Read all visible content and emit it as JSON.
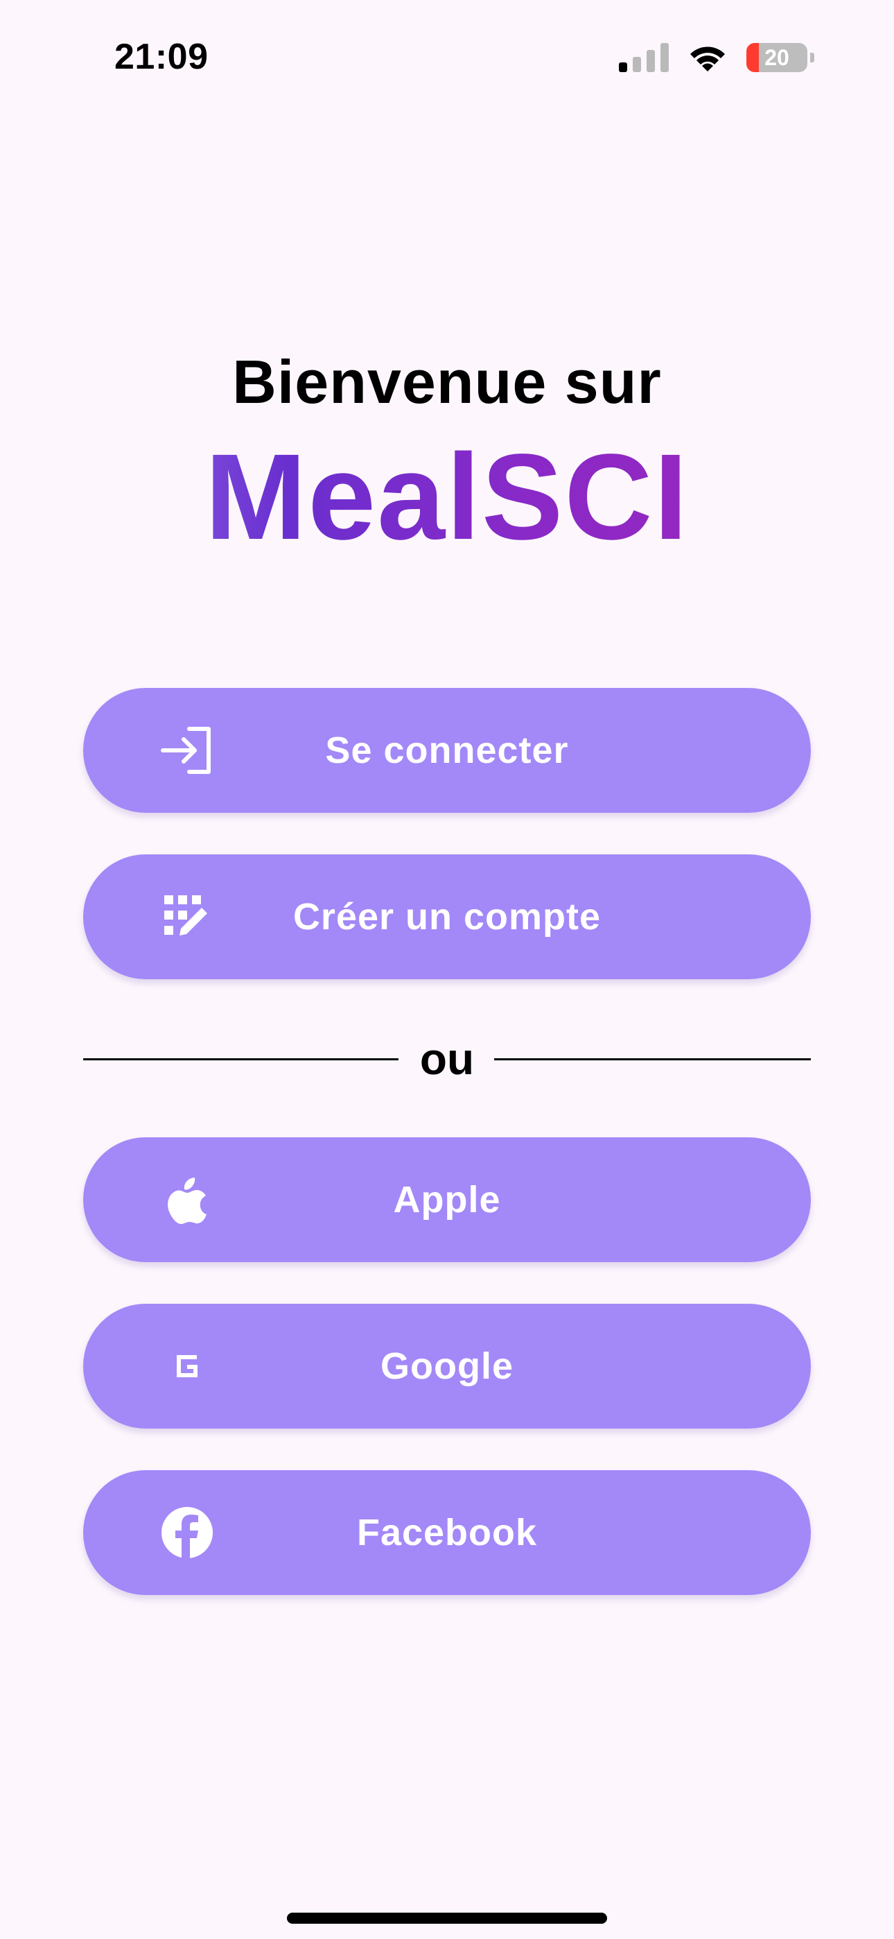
{
  "status_bar": {
    "time": "21:09",
    "battery_level": "20",
    "battery_fraction": 0.2,
    "battery_color": "#ff3b30"
  },
  "header": {
    "welcome": "Bienvenue sur",
    "brand": "MealSCI"
  },
  "buttons": {
    "login": {
      "label": "Se connecter",
      "icon": "login-icon"
    },
    "register": {
      "label": "Créer un compte",
      "icon": "create-account-icon"
    },
    "apple": {
      "label": "Apple",
      "icon": "apple-icon"
    },
    "google": {
      "label": "Google",
      "icon": "google-icon"
    },
    "facebook": {
      "label": "Facebook",
      "icon": "facebook-icon"
    }
  },
  "divider": {
    "text": "ou"
  },
  "colors": {
    "background": "#fdf7fd",
    "button": "#a388f8",
    "brand_gradient": [
      "#9b7ff0",
      "#6a2fcf",
      "#8a29c7",
      "#a126b8"
    ]
  }
}
